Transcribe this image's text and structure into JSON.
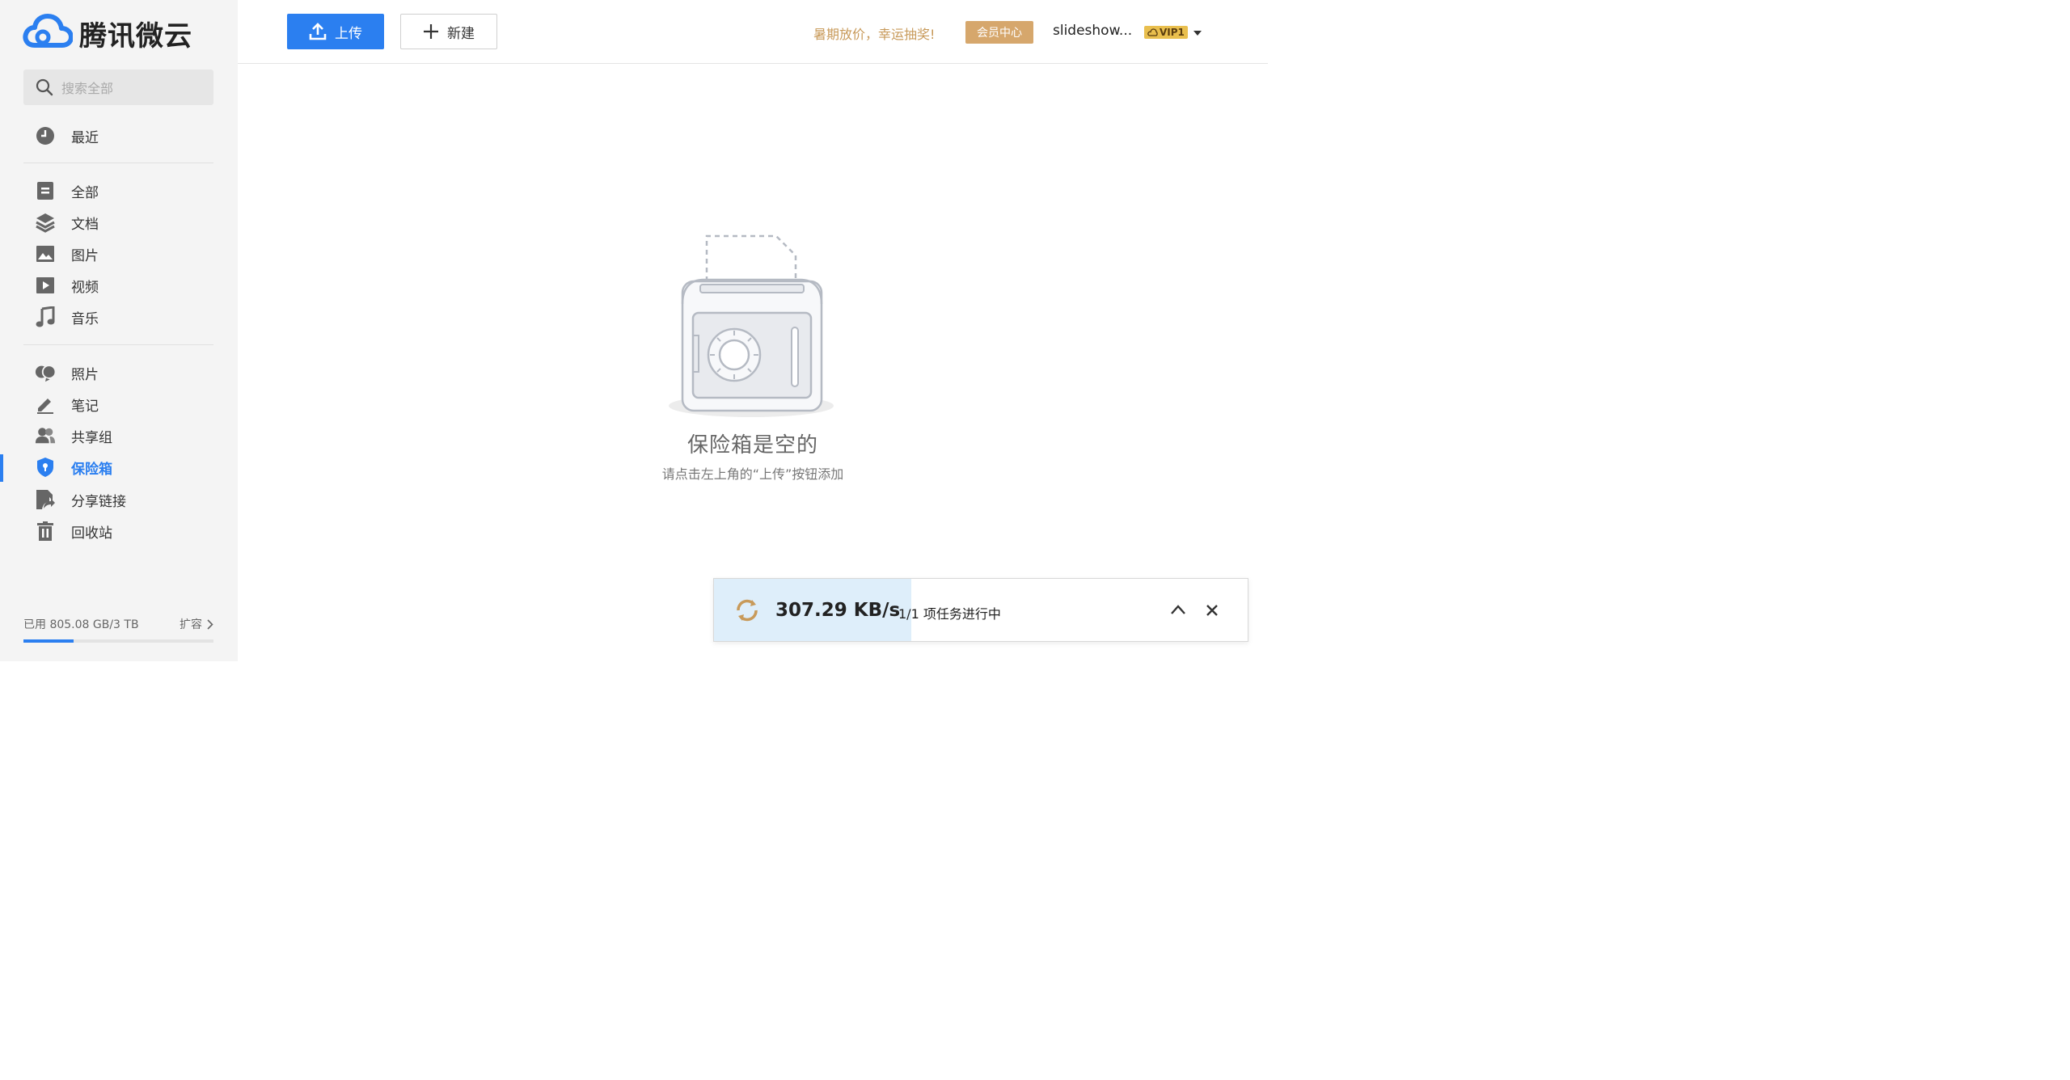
{
  "app": {
    "logo_text": "腾讯微云"
  },
  "search": {
    "placeholder": "搜索全部"
  },
  "sidebar": {
    "recent": {
      "label": "最近",
      "icon": "clock-icon"
    },
    "files": [
      {
        "label": "全部",
        "icon": "all-files-icon"
      },
      {
        "label": "文档",
        "icon": "layers-icon"
      },
      {
        "label": "图片",
        "icon": "image-icon"
      },
      {
        "label": "视频",
        "icon": "play-icon"
      },
      {
        "label": "音乐",
        "icon": "music-icon"
      }
    ],
    "tools": [
      {
        "label": "照片",
        "icon": "photos-icon"
      },
      {
        "label": "笔记",
        "icon": "pencil-icon"
      },
      {
        "label": "共享组",
        "icon": "people-icon"
      },
      {
        "label": "保险箱",
        "icon": "shield-icon",
        "active": true
      },
      {
        "label": "分享链接",
        "icon": "share-icon"
      },
      {
        "label": "回收站",
        "icon": "trash-icon"
      }
    ]
  },
  "storage": {
    "used_text": "已用 805.08 GB/3 TB",
    "expand_label": "扩容",
    "used_fraction": 0.262
  },
  "toolbar": {
    "upload_label": "上传",
    "new_label": "新建"
  },
  "header": {
    "promo": "暑期放价，幸运抽奖!",
    "vip_center": "会员中心",
    "username": "slideshow...",
    "vip_level": "VIP1"
  },
  "empty_state": {
    "title": "保险箱是空的",
    "subtitle": "请点击左上角的“上传”按钮添加"
  },
  "transfer": {
    "speed": "307.29 KB/s",
    "status": "1/1 项任务进行中",
    "progress_fraction": 0.37
  },
  "colors": {
    "accent": "#2b7ff0",
    "gold": "#d6a76c",
    "promo": "#c89a5a",
    "progress": "#deeefa"
  }
}
